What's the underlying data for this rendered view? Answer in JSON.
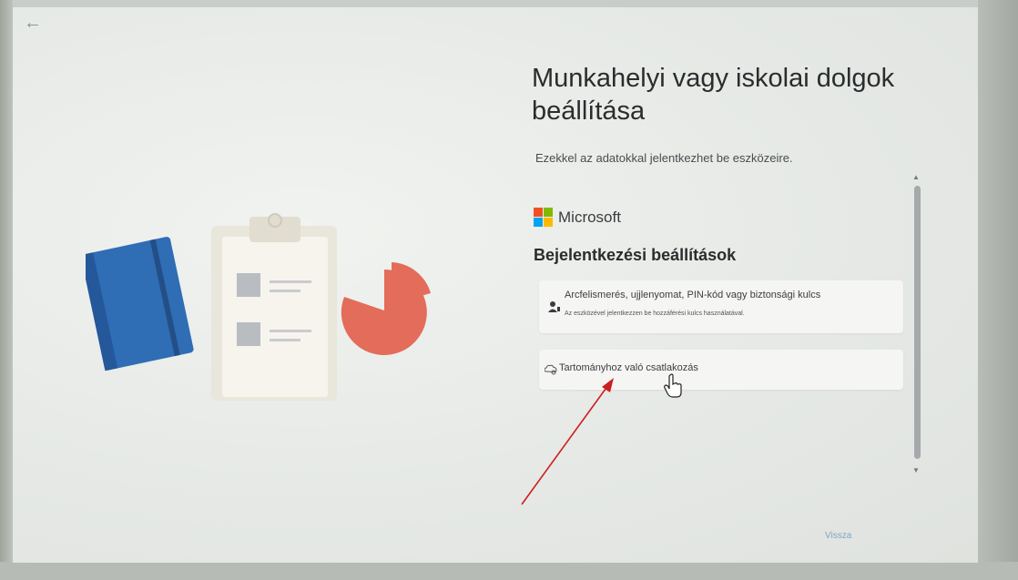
{
  "nav": {
    "back_glyph": "←",
    "back_icon": "back-arrow-icon"
  },
  "illustration": {
    "notebook_color": "#2f6db5",
    "clipboard_color": "#f3f0e6",
    "pie_color": "#e36c5a",
    "icon_names": [
      "notebook-icon",
      "clipboard-icon",
      "pie-chart-icon"
    ]
  },
  "setup": {
    "title": "Munkahelyi vagy iskolai dolgok beállítása",
    "subtitle": "Ezekkel az adatokkal jelentkezhet be eszközeire.",
    "brand": "Microsoft",
    "section_title": "Bejelentkezési beállítások",
    "options": [
      {
        "title": "Arcfelismerés, ujjlenyomat, PIN-kód vagy biztonsági kulcs",
        "description": "Az eszközével jelentkezzen be hozzáférési kulcs használatával.",
        "icon": "user-key-icon"
      },
      {
        "title": "Tartományhoz való csatlakozás",
        "icon": "domain-join-icon"
      }
    ],
    "back_button": "Vissza"
  },
  "colors": {
    "ms_red": "#f25022",
    "ms_green": "#7fba00",
    "ms_blue": "#00a4ef",
    "ms_yellow": "#ffb900",
    "annotation_arrow": "#cc1f1f"
  }
}
